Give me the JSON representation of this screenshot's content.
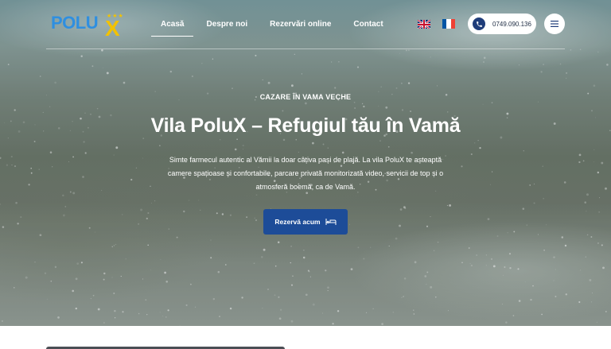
{
  "brand": {
    "logo_word": "POLU",
    "logo_x": "X",
    "logo_stars": "★★★"
  },
  "nav": {
    "items": [
      {
        "label": "Acasă",
        "active": true
      },
      {
        "label": "Despre noi",
        "active": false
      },
      {
        "label": "Rezervări online",
        "active": false
      },
      {
        "label": "Contact",
        "active": false
      }
    ]
  },
  "languages": {
    "flags": [
      "uk-flag-icon",
      "france-flag-icon"
    ]
  },
  "contact": {
    "phone": "0749.090.136",
    "icon": "phone-icon"
  },
  "menu": {
    "icon": "hamburger-menu-icon"
  },
  "hero": {
    "eyebrow": "CAZARE ÎN VAMA VECHE",
    "title": "Vila PoluX – Refugiul tău în Vamă",
    "description_lines": [
      "Simte farmecul autentic al Vămii la doar câțiva pași de plajă. La vila PoluX te așteaptă",
      "camere spațioase și confortabile, parcare privată monitorizată video, servicii de top și o",
      "atmosferă boemă, ca de Vamă."
    ],
    "cta_label": "Rezervă acum",
    "cta_icon": "bed-icon"
  },
  "colors": {
    "accent": "#1d4c98",
    "logo_blue": "#2f8fe0",
    "logo_yellow": "#f2c200",
    "text_on_hero": "#ffffff"
  }
}
